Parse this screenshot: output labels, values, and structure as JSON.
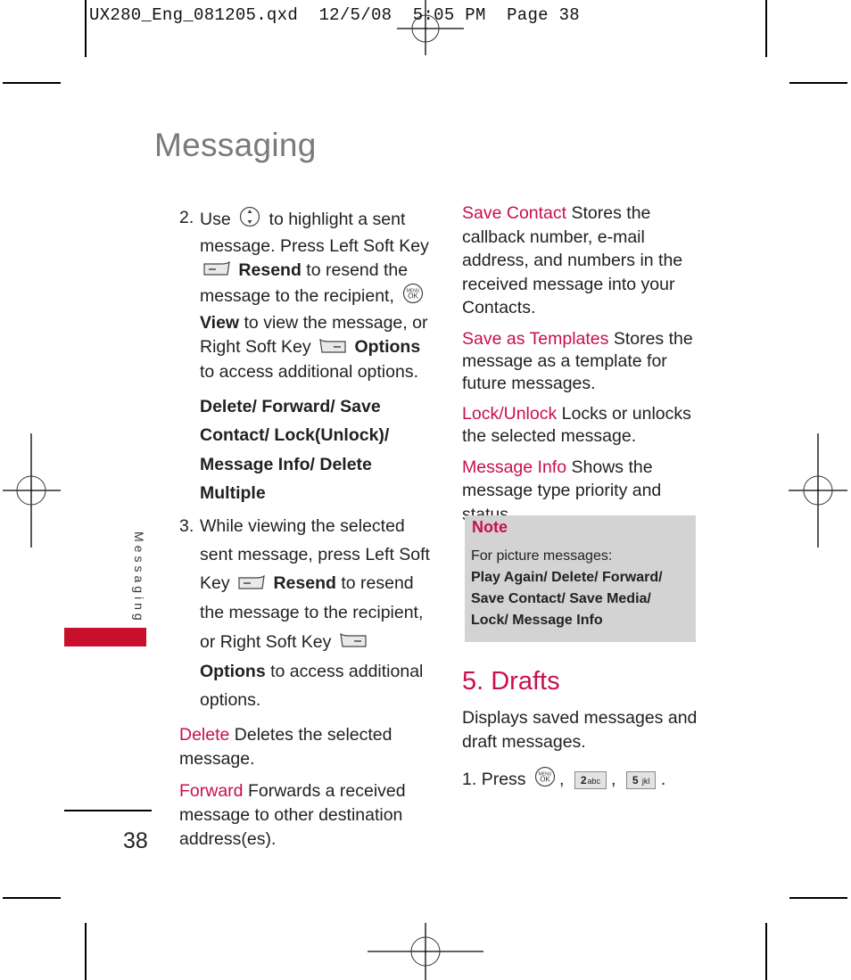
{
  "header": {
    "slug": "UX280_Eng_081205.qxd  12/5/08  5:05 PM  Page 38"
  },
  "page": {
    "title": "Messaging",
    "side_tab_label": "Messaging",
    "page_number": "38",
    "accent_color": "#c8104a"
  },
  "left_column": {
    "step2": {
      "number": "2.",
      "text_1": "Use",
      "text_2": "to highlight a sent message. Press Left Soft Key",
      "resend_label": "Resend",
      "text_3": "to resend the message to the recipient,",
      "view_label": "View",
      "text_4": "to view the message, or Right Soft Key",
      "options_label": "Options",
      "text_5": "to access additional options."
    },
    "options_list": "Delete/ Forward/ Save Contact/ Lock(Unlock)/ Message Info/ Delete Multiple",
    "step3": {
      "number": "3.",
      "text_1": "While viewing the selected sent message, press Left Soft Key",
      "resend_label": "Resend",
      "text_2": "to resend the message to the recipient, or Right Soft Key",
      "options_label": "Options",
      "text_3": "to access additional options."
    },
    "definitions": [
      {
        "term": "Delete",
        "description": "Deletes the selected message."
      },
      {
        "term": "Forward",
        "description": "Forwards a received message to other destination address(es)."
      }
    ]
  },
  "right_column": {
    "definitions": [
      {
        "term": "Save Contact",
        "description": "Stores the callback number, e-mail address, and numbers in the received message into your Contacts."
      },
      {
        "term": "Save as Templates",
        "description": "Stores the message as a template for future messages."
      },
      {
        "term": "Lock/Unlock",
        "description": "Locks or unlocks the selected message."
      },
      {
        "term": "Message Info",
        "description": "Shows the message type priority and status."
      }
    ],
    "note": {
      "title": "Note",
      "intro": "For picture messages:",
      "options": "Play Again/ Delete/ Forward/ Save Contact/ Save Media/ Lock/  Message Info"
    },
    "drafts": {
      "heading": "5. Drafts",
      "description": "Displays saved messages and draft messages.",
      "step_number": "1.",
      "step_text": "Press",
      "keys": [
        {
          "name": "menu-ok-key",
          "label": "MENU OK"
        },
        {
          "name": "key-2",
          "digit": "2",
          "letters": "abc"
        },
        {
          "name": "key-5",
          "digit": "5",
          "letters": "jkl"
        }
      ],
      "separator": ",",
      "end": "."
    }
  }
}
